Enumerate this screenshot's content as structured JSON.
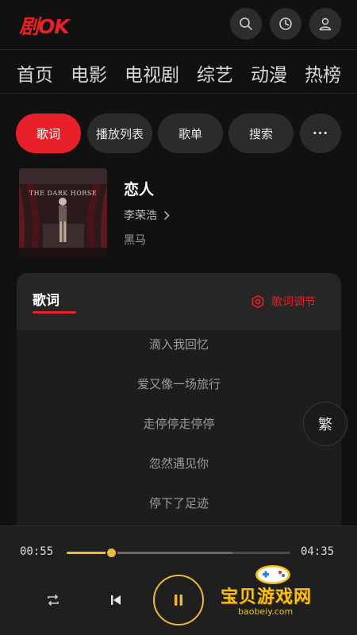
{
  "app": {
    "logo_text": "剧OK"
  },
  "header": {
    "buttons": [
      {
        "icon": "search-icon"
      },
      {
        "icon": "history-icon"
      },
      {
        "icon": "user-icon"
      }
    ]
  },
  "nav": {
    "items": [
      "首页",
      "电影",
      "电视剧",
      "综艺",
      "动漫",
      "热榜"
    ]
  },
  "tabs": {
    "items": [
      "歌词",
      "播放列表",
      "歌单",
      "搜索"
    ],
    "more_label": "···",
    "active": "歌词"
  },
  "song": {
    "title": "恋人",
    "artist": "李荣浩",
    "album": "黑马",
    "cover_text": "THE DARK HORSE"
  },
  "lyrics": {
    "tab_label": "歌词",
    "adjust_label": "歌词调节",
    "lines": [
      "滴入我回忆",
      "爱又像一场旅行",
      "走停停走停停",
      "忽然遇见你",
      "停下了足迹"
    ]
  },
  "trad_button": "繁",
  "player": {
    "elapsed": "00:55",
    "total": "04:35",
    "progress": 0.2,
    "buffered": 0.74
  },
  "watermark": {
    "text": "宝贝游戏网",
    "url": "baobeiy.com"
  },
  "colors": {
    "accent": "#e8202a",
    "progress": "#f0b93a",
    "background": "#111111"
  }
}
